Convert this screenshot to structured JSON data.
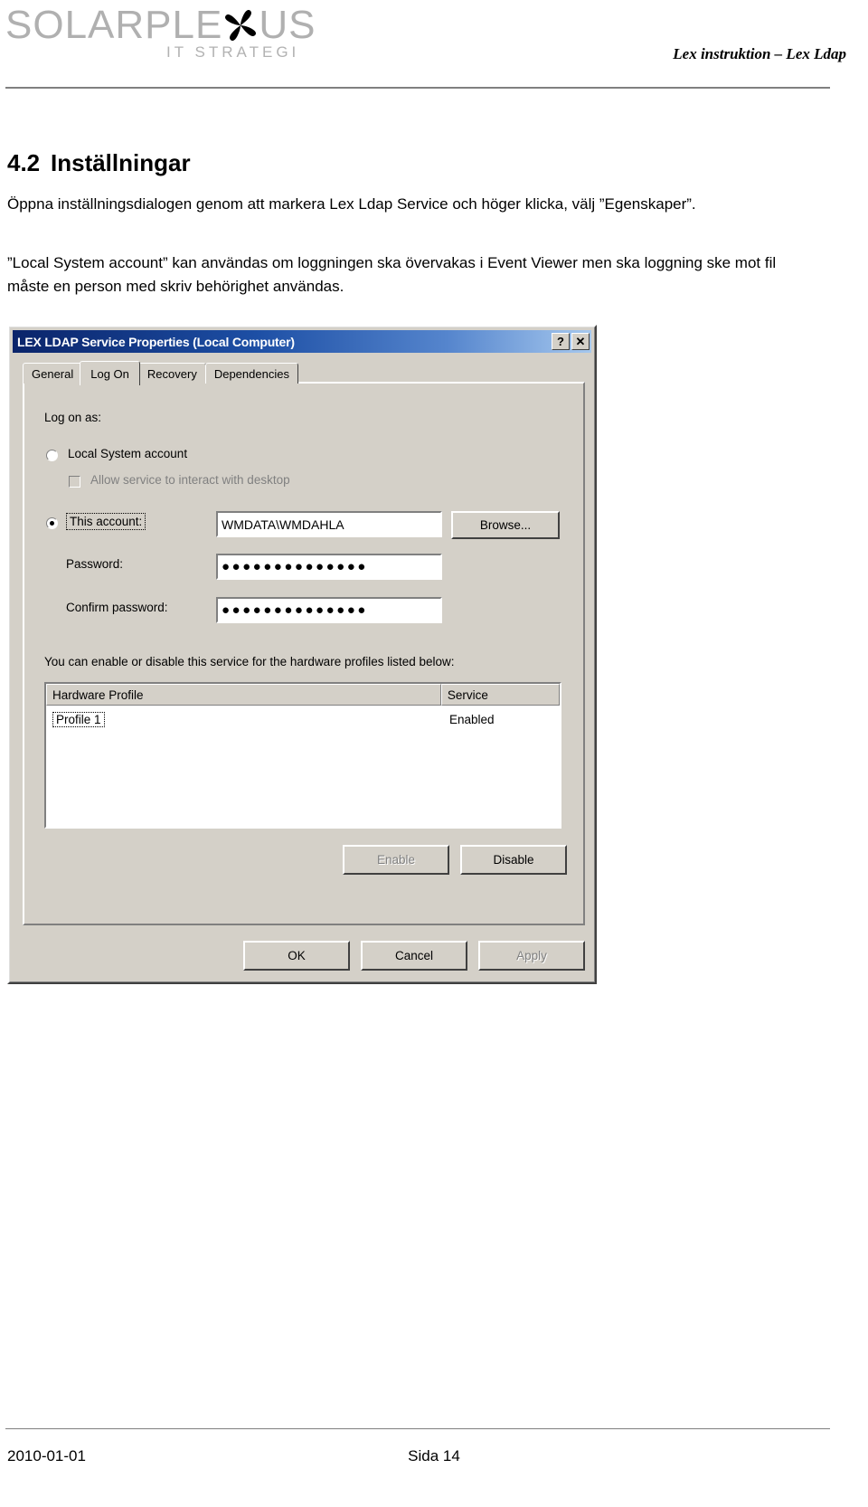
{
  "header": {
    "logo_text": "SOLARPLE",
    "logo_text_after": "US",
    "logo_subtitle": "IT STRATEGI",
    "doc_title": "Lex instruktion – Lex Ldap",
    "logo_color": "#b0b0b0",
    "rule_color": "#808080"
  },
  "content": {
    "heading_number": "4.2",
    "heading_text": "Inställningar",
    "paragraph_1": "Öppna inställningsdialogen genom att markera Lex Ldap Service och höger klicka, välj ”Egenskaper”.",
    "paragraph_2": "”Local System account” kan användas om loggningen ska övervakas i Event Viewer men ska loggning ske mot fil måste en person med skriv behörighet användas."
  },
  "dialog": {
    "title": "LEX LDAP Service Properties (Local Computer)",
    "help_button": "?",
    "close_button": "✕",
    "titlebar_color": "#0a246a",
    "face_color": "#d4d0c8",
    "tabs": [
      {
        "label": "General",
        "active": false
      },
      {
        "label": "Log On",
        "active": true
      },
      {
        "label": "Recovery",
        "active": false
      },
      {
        "label": "Dependencies",
        "active": false
      }
    ],
    "logon_as_label": "Log on as:",
    "local_system": {
      "label": "Local System account",
      "selected": false
    },
    "allow_desktop": {
      "label": "Allow service to interact with desktop",
      "checked": false,
      "disabled": true
    },
    "this_account": {
      "label": "This account:",
      "selected": true,
      "value": "WMDATA\\WMDAHLA",
      "browse_label": "Browse..."
    },
    "password": {
      "label": "Password:",
      "value": "●●●●●●●●●●●●●●"
    },
    "confirm_password": {
      "label": "Confirm password:",
      "value": "●●●●●●●●●●●●●●"
    },
    "profiles_hint": "You can enable or disable this service for the hardware profiles listed below:",
    "profiles_table": {
      "columns": [
        "Hardware Profile",
        "Service"
      ],
      "rows": [
        {
          "profile": "Profile 1",
          "service": "Enabled"
        }
      ]
    },
    "enable_button": {
      "label": "Enable",
      "disabled": true
    },
    "disable_button": {
      "label": "Disable",
      "disabled": false
    },
    "ok_button": {
      "label": "OK",
      "disabled": false
    },
    "cancel_button": {
      "label": "Cancel",
      "disabled": false
    },
    "apply_button": {
      "label": "Apply",
      "disabled": true
    }
  },
  "footer": {
    "date": "2010-01-01",
    "page": "Sida 14"
  }
}
